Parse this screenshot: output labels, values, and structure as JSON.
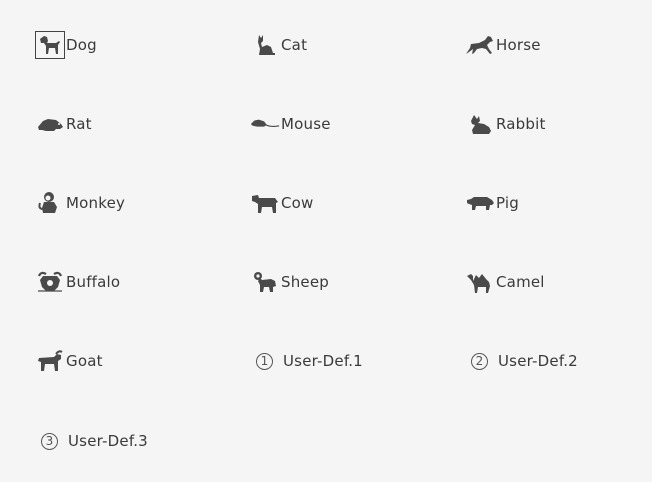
{
  "species": {
    "dog": {
      "label": "Dog",
      "icon": "dog-icon",
      "selected": true
    },
    "cat": {
      "label": "Cat",
      "icon": "cat-icon"
    },
    "horse": {
      "label": "Horse",
      "icon": "horse-icon"
    },
    "rat": {
      "label": "Rat",
      "icon": "rat-icon"
    },
    "mouse": {
      "label": "Mouse",
      "icon": "mouse-icon"
    },
    "rabbit": {
      "label": "Rabbit",
      "icon": "rabbit-icon"
    },
    "monkey": {
      "label": "Monkey",
      "icon": "monkey-icon"
    },
    "cow": {
      "label": "Cow",
      "icon": "cow-icon"
    },
    "pig": {
      "label": "Pig",
      "icon": "pig-icon"
    },
    "buffalo": {
      "label": "Buffalo",
      "icon": "buffalo-icon"
    },
    "sheep": {
      "label": "Sheep",
      "icon": "sheep-icon"
    },
    "camel": {
      "label": "Camel",
      "icon": "camel-icon"
    },
    "goat": {
      "label": "Goat",
      "icon": "goat-icon"
    },
    "user_def_1": {
      "label": "User-Def.1",
      "icon": "circled-1-icon",
      "marker": "1"
    },
    "user_def_2": {
      "label": "User-Def.2",
      "icon": "circled-2-icon",
      "marker": "2"
    },
    "user_def_3": {
      "label": "User-Def.3",
      "icon": "circled-3-icon",
      "marker": "3"
    }
  },
  "colors": {
    "background": "#f5f5f5",
    "icon": "#4a4a4a",
    "text": "#3a3a3a"
  }
}
